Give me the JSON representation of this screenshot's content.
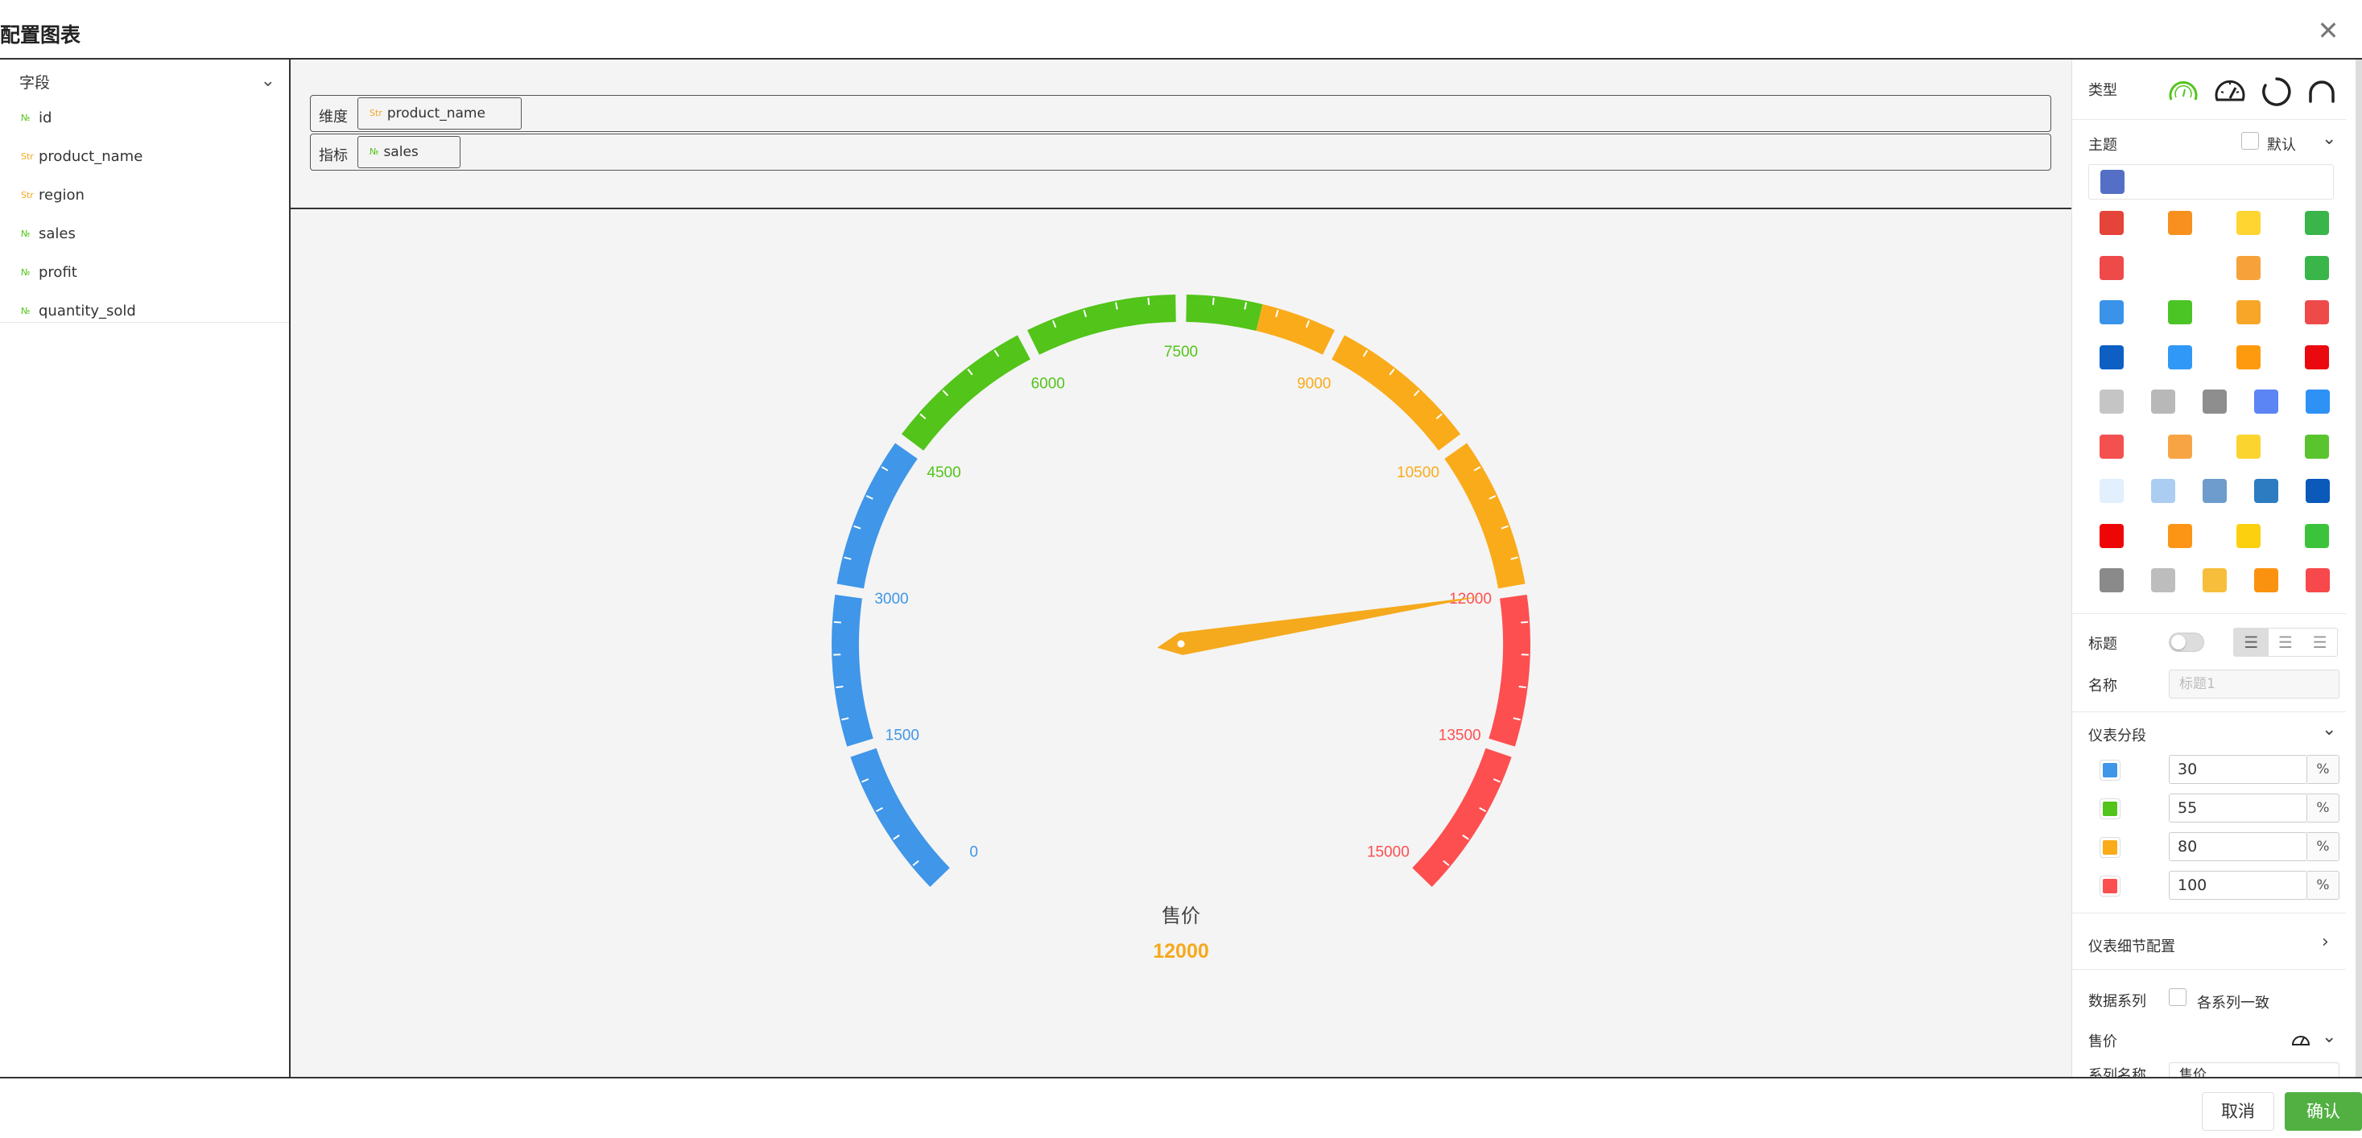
{
  "dialog": {
    "title": "配置图表",
    "close_icon": "close-icon"
  },
  "fields": {
    "header": "字段",
    "items": [
      {
        "type": "num",
        "type_mark": "№",
        "name": "id"
      },
      {
        "type": "str",
        "type_mark": "Str",
        "name": "product_name"
      },
      {
        "type": "str",
        "type_mark": "Str",
        "name": "region"
      },
      {
        "type": "num",
        "type_mark": "№",
        "name": "sales"
      },
      {
        "type": "num",
        "type_mark": "№",
        "name": "profit"
      },
      {
        "type": "num",
        "type_mark": "№",
        "name": "quantity_sold"
      }
    ]
  },
  "slots": {
    "dimension": {
      "label": "维度",
      "chip": "product_name",
      "chip_type": "Str"
    },
    "metric": {
      "label": "指标",
      "chip": "sales",
      "chip_type": "№"
    }
  },
  "chart_data": {
    "type": "gauge",
    "min": 0,
    "max": 15000,
    "value": 12000,
    "series_name": "售价",
    "value_label": "12000",
    "tick_labels": [
      "0",
      "1500",
      "3000",
      "4500",
      "6000",
      "7500",
      "9000",
      "10500",
      "12000",
      "13500",
      "15000"
    ],
    "segments": [
      {
        "upto_percent": 30,
        "color": "#4096e8"
      },
      {
        "upto_percent": 55,
        "color": "#52c41a"
      },
      {
        "upto_percent": 80,
        "color": "#faab1a"
      },
      {
        "upto_percent": 100,
        "color": "#fd4f50"
      }
    ],
    "pointer_color": "#f5a91c"
  },
  "panel": {
    "type_label": "类型",
    "type_icons": [
      "gauge-simple-icon",
      "speedometer-icon",
      "ring-progress-icon",
      "arc-icon"
    ],
    "theme_label": "主题",
    "theme_default_label": "默认",
    "theme_selected": [
      "#5470c6"
    ],
    "themes": [
      [
        "#e4443a",
        "#f7901e",
        "#fed531",
        "#39b54a"
      ],
      [
        "#ef4a4a",
        "",
        "#f7a13a",
        "#39b54a"
      ],
      [
        "#3a93e8",
        "#4bc425",
        "#f7a628",
        "#ef4a4a"
      ],
      [
        "#0d5fc4",
        "#3099f7",
        "#fd9a0e",
        "#e9090f"
      ],
      [
        "#c5c5c5",
        "#b8b8b8",
        "#8e8e8e",
        "#5b84f4",
        "#2e91f5"
      ],
      [
        "#f45050",
        "#f7a544",
        "#fbd42f",
        "#5ac42e"
      ],
      [
        "#e2effc",
        "#abcdf1",
        "#6e9ccc",
        "#2d7cc1",
        "#0b5aba"
      ],
      [
        "#ee0606",
        "#fc9515",
        "#fcd00f",
        "#3bc43b"
      ],
      [
        "#8a8a8a",
        "#bdbdbd",
        "#f7be3c",
        "#fb920f",
        "#f7484b"
      ]
    ],
    "title_label": "标题",
    "name_label": "名称",
    "name_placeholder": "标题1",
    "segments_label": "仪表分段",
    "segment_values": [
      "30",
      "55",
      "80",
      "100"
    ],
    "segment_unit": "%",
    "detail_label": "仪表细节配置",
    "data_series_label": "数据系列",
    "series_consistent_label": "各系列一致",
    "series_item_label": "售价",
    "series_name_label": "系列名称",
    "series_name_value": "售价"
  },
  "footer": {
    "cancel": "取消",
    "confirm": "确认"
  }
}
